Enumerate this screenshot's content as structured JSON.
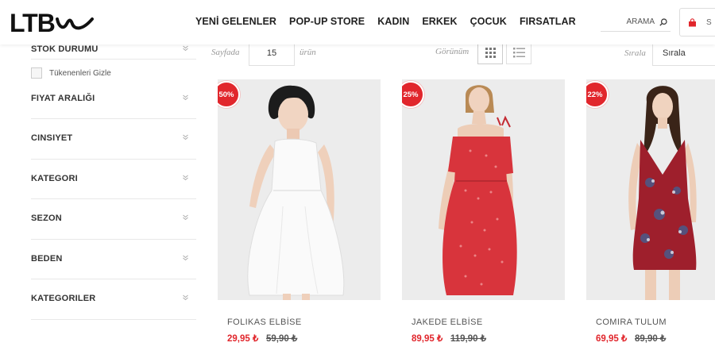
{
  "header": {
    "logo_text": "LTB",
    "nav": [
      "YENİ GELENLER",
      "POP-UP STORE",
      "KADIN",
      "ERKEK",
      "ÇOCUK",
      "FIRSATLAR"
    ],
    "search_placeholder": "ARAMA",
    "cart_text": "S"
  },
  "filters": {
    "stock_title": "STOK DURUMU",
    "hide_sold_out": "Tükenenleri Gizle",
    "items": [
      "FIYAT ARALIĞI",
      "CINSIYET",
      "KATEGORI",
      "SEZON",
      "BEDEN",
      "KATEGORILER"
    ]
  },
  "toolbar": {
    "per_page_label": "Sayfada",
    "per_page_value": "15",
    "per_page_unit": "ürün",
    "view_label": "Görünüm",
    "sort_label": "Sırala",
    "sort_value": "Sırala"
  },
  "products": [
    {
      "badge": "50%",
      "name": "FOLIKAS ELBİSE",
      "price": "29,95 ₺",
      "old_price": "59,90 ₺",
      "dress_color": "#fafafa"
    },
    {
      "badge": "25%",
      "name": "JAKEDE ELBİSE",
      "price": "89,95 ₺",
      "old_price": "119,90 ₺",
      "dress_color": "#d8343c"
    },
    {
      "badge": "22%",
      "name": "COMIRA TULUM",
      "price": "69,95 ₺",
      "old_price": "89,90 ₺",
      "dress_color": "#9e1f2c"
    }
  ],
  "colors": {
    "accent": "#e1262c",
    "background": "#ffffff",
    "image_bg": "#ececec"
  }
}
